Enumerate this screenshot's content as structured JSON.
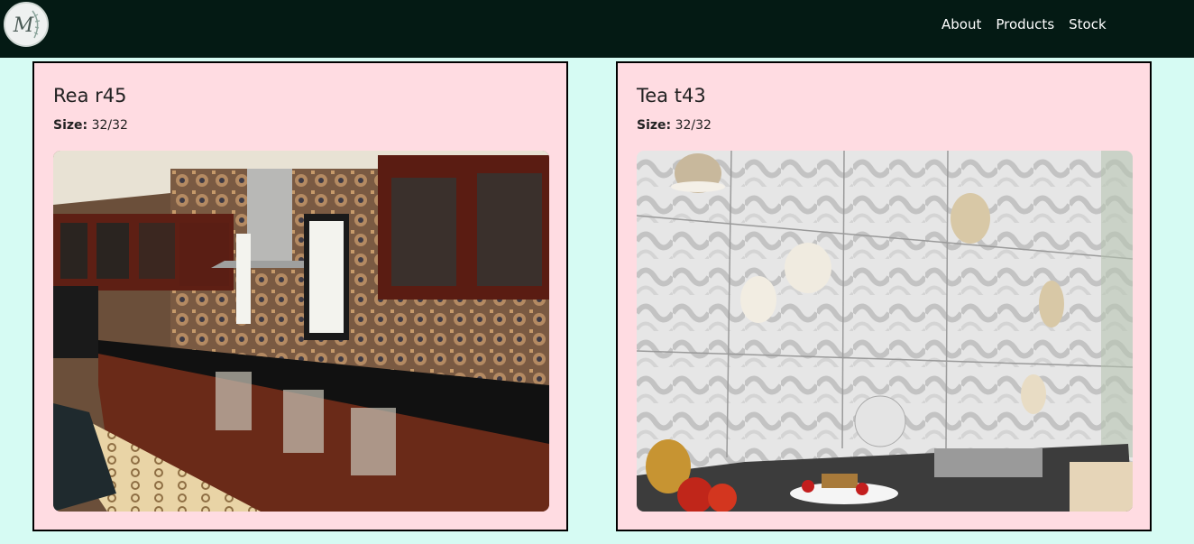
{
  "navbar": {
    "logo_letter": "M",
    "links": [
      "About",
      "Products",
      "Stock"
    ]
  },
  "products": [
    {
      "name": "Rea r45",
      "size_label": "Size:",
      "size_value": "32/32",
      "image": "kitchen-moroccan-tiles-photo"
    },
    {
      "name": "Tea t43",
      "size_label": "Size:",
      "size_value": "32/32",
      "image": "kitchen-white-3d-tiles-photo"
    }
  ],
  "colors": {
    "navbar_bg": "#041a14",
    "page_bg": "#d6fbf3",
    "card_bg": "#ffdce2",
    "card_border": "#000000"
  }
}
